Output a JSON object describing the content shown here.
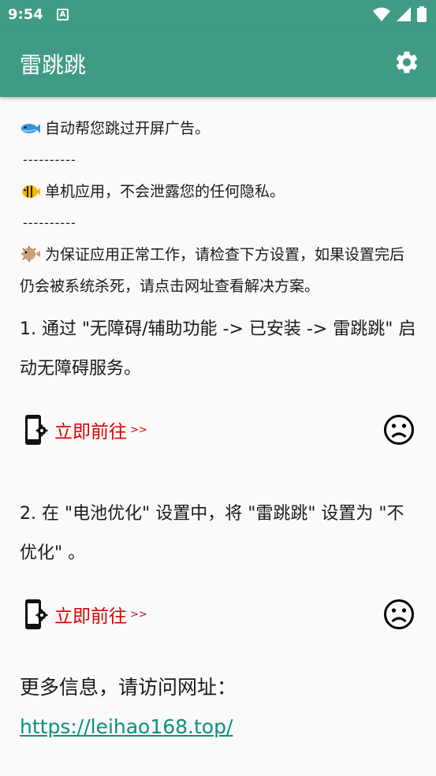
{
  "status_bar": {
    "time": "9:54",
    "notification_glyph": "A"
  },
  "app_bar": {
    "title": "雷跳跳",
    "settings_icon": "gear-icon"
  },
  "intro": {
    "line1": "自动帮您跳过开屏广告。",
    "divider1": "----------",
    "line2": "单机应用，不会泄露您的任何隐私。",
    "divider2": "----------",
    "line3": "为保证应用正常工作，请检查下方设置，如果设置完后仍会被系统杀死，请点击网址查看解决方案。"
  },
  "steps": [
    {
      "text": "1. 通过 \"无障碍/辅助功能 -> 已安装 -> 雷跳跳\" 启动无障碍服务。",
      "action": "立即前往",
      "arrow": ">>"
    },
    {
      "text": "2. 在 \"电池优化\" 设置中，将 \"雷跳跳\" 设置为 \"不优化\" 。",
      "action": "立即前往",
      "arrow": ">>"
    }
  ],
  "footer": {
    "more_info": "更多信息，请访问网址：",
    "url": "https://leihao168.top/"
  },
  "colors": {
    "primary": "#3f9b84",
    "action_red": "#e00000",
    "link_teal": "#0d8f80"
  }
}
